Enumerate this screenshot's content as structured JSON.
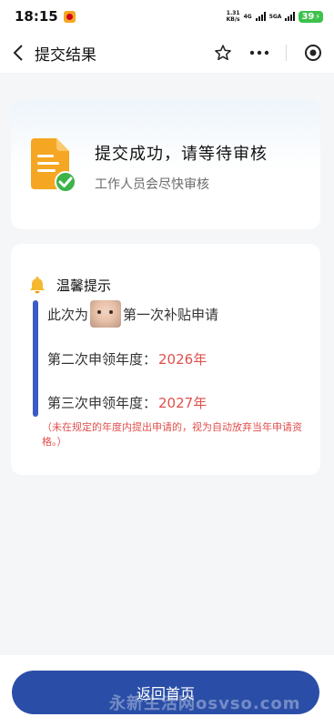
{
  "status_bar": {
    "time": "18:15",
    "net_speed_value": "1.31",
    "net_speed_unit": "KB/s",
    "net_type_1": "4G",
    "net_type_2": "5GA",
    "battery": "39"
  },
  "nav": {
    "title": "提交结果"
  },
  "result": {
    "title": "提交成功，请等待审核",
    "subtitle": "工作人员会尽快审核"
  },
  "tips": {
    "title": "温馨提示",
    "row1_prefix": "此次为",
    "row1_suffix": "第一次补贴申请",
    "row2_label": "第二次申领年度：",
    "row2_year": "2026年",
    "row3_label": "第三次申领年度：",
    "row3_year": "2027年",
    "note": "（未在规定的年度内提出申请的，视为自动放弃当年申请资格。）"
  },
  "footer": {
    "home_button": "返回首页",
    "watermark": "永新生活网osvso.com"
  },
  "colors": {
    "accent": "#2a4ea7",
    "highlight": "#e0504d",
    "success": "#3cc24a",
    "doc_orange": "#f5a623"
  }
}
